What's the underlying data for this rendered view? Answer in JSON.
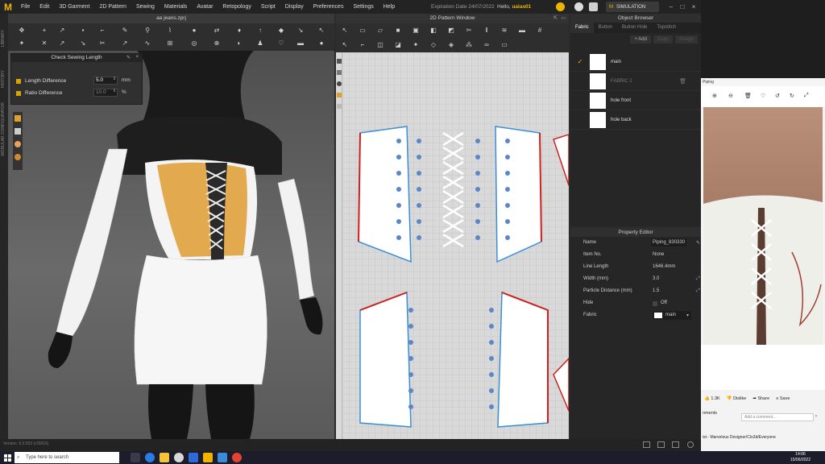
{
  "app": {
    "menu": [
      "File",
      "Edit",
      "3D Garment",
      "2D Pattern",
      "Sewing",
      "Materials",
      "Avatar",
      "Retopology",
      "Script",
      "Display",
      "Preferences",
      "Settings",
      "Help"
    ],
    "expiry": "Expiration Date 24/07/2022",
    "hello_prefix": "Hello,",
    "username": "ualas01",
    "simulation_label": "SIMULATION",
    "accent_color": "#f0b400"
  },
  "window3d": {
    "title": "aa jeans.zprj",
    "left_strip": [
      "LIBRARY",
      "HISTORY",
      "MODULAR CONFIGURATOR"
    ]
  },
  "check_sewing_length": {
    "title": "Check Sewing Length",
    "length_label": "Length Difference",
    "length_value": "5.0",
    "length_unit": "mm",
    "ratio_label": "Ratio Difference",
    "ratio_value": "10.0",
    "ratio_unit": "%"
  },
  "window2d": {
    "title": "2D Pattern Window"
  },
  "object_browser": {
    "title": "Object Browser",
    "tabs": [
      "Fabric",
      "Button",
      "Button Hole",
      "Topstitch"
    ],
    "actions": {
      "add": "+ Add",
      "copy": "Copy",
      "assign": "Assign"
    },
    "fabrics": [
      {
        "name": "main",
        "checked": true,
        "dim": false
      },
      {
        "name": "FABRIC 2",
        "checked": false,
        "dim": true
      },
      {
        "name": "hole front",
        "checked": false,
        "dim": false
      },
      {
        "name": "hole back",
        "checked": false,
        "dim": false
      }
    ]
  },
  "property_editor": {
    "title": "Property Editor",
    "rows": [
      {
        "label": "Name",
        "value": "Piping_830330"
      },
      {
        "label": "Item No.",
        "value": "None"
      },
      {
        "label": "Line Length",
        "value": "1646.4mm"
      },
      {
        "label": "Width (mm)",
        "value": "3.0"
      },
      {
        "label": "Particle Distance (mm)",
        "value": "1.5"
      },
      {
        "label": "Hide",
        "value": "Off"
      },
      {
        "label": "Fabric",
        "value": "main"
      }
    ]
  },
  "statusbar": {
    "version": "Version: 6.0.553 (r33816)"
  },
  "browser": {
    "tab_label": "Piping",
    "likes": "1.3K",
    "dislike": "Dislike",
    "share": "Share",
    "save": "Save",
    "comments": "nments",
    "comment_placeholder": "Add a comment...",
    "video_title": "ist - Marvelous Designer/Clo3d/Everyone"
  },
  "taskbar": {
    "search_placeholder": "Type here to search",
    "time": "14:06",
    "date": "15/06/2022"
  }
}
